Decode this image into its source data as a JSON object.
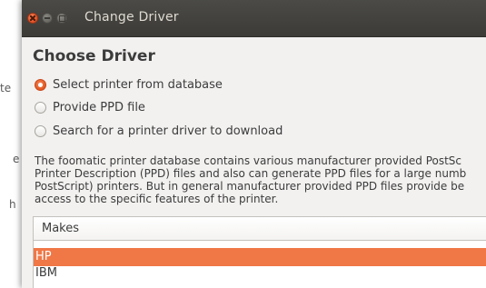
{
  "background": {
    "left_fragments": [
      "te",
      "e",
      "h"
    ]
  },
  "window": {
    "title": "Change Driver",
    "buttons": [
      "close",
      "minimize",
      "maximize"
    ],
    "accent_color": "#e4542a"
  },
  "dialog": {
    "heading": "Choose Driver",
    "options": [
      {
        "label": "Select printer from database",
        "checked": true
      },
      {
        "label": "Provide PPD file",
        "checked": false
      },
      {
        "label": "Search for a printer driver to download",
        "checked": false
      }
    ],
    "description_lines": [
      "The foomatic printer database contains various manufacturer provided PostSc",
      "Printer Description (PPD) files and also can generate PPD files for a large numb",
      "PostScript) printers. But in general manufacturer provided PPD files provide be",
      "access to the specific features of the printer."
    ],
    "makes": {
      "header": "Makes",
      "items": [
        {
          "label": "HP",
          "selected": true
        },
        {
          "label": "IBM",
          "selected": false
        }
      ],
      "selection_color": "#f07746"
    }
  }
}
